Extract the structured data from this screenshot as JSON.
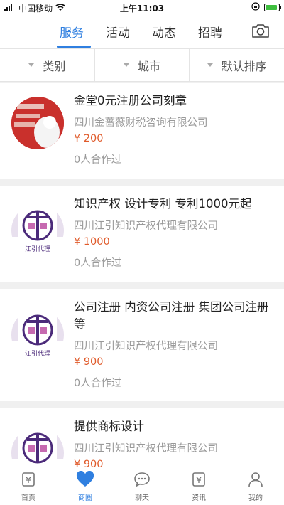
{
  "status": {
    "carrier": "中国移动",
    "time": "上午11:03"
  },
  "tabs": [
    {
      "label": "服务",
      "active": true
    },
    {
      "label": "活动",
      "active": false
    },
    {
      "label": "动态",
      "active": false
    },
    {
      "label": "招聘",
      "active": false
    }
  ],
  "filters": [
    {
      "label": "类别"
    },
    {
      "label": "城市"
    },
    {
      "label": "默认排序"
    }
  ],
  "listings": [
    {
      "title": "金堂0元注册公司刻章",
      "company": "四川金蔷薇财税咨询有限公司",
      "price": "¥ 200",
      "coop": "0人合作过",
      "thumb": "red-promo-image"
    },
    {
      "title": "知识产权 设计专利 专利1000元起",
      "company": "四川江引知识产权代理有限公司",
      "price": "¥ 1000",
      "coop": "0人合作过",
      "thumb": "jiangyin-logo"
    },
    {
      "title": "公司注册 内资公司注册 集团公司注册等",
      "company": "四川江引知识产权代理有限公司",
      "price": "¥ 900",
      "coop": "0人合作过",
      "thumb": "jiangyin-logo"
    },
    {
      "title": "提供商标设计",
      "company": "四川江引知识产权代理有限公司",
      "price": "¥ 900",
      "coop": "",
      "thumb": "jiangyin-logo"
    }
  ],
  "bottom_tabs": [
    {
      "label": "首页",
      "icon": "home-icon",
      "active": false
    },
    {
      "label": "商圈",
      "icon": "heart-icon",
      "active": true
    },
    {
      "label": "聊天",
      "icon": "chat-icon",
      "active": false
    },
    {
      "label": "资讯",
      "icon": "news-icon",
      "active": false
    },
    {
      "label": "我的",
      "icon": "profile-icon",
      "active": false
    }
  ],
  "colors": {
    "accent": "#2f7fe0",
    "price": "#e05a2a",
    "logo_purple": "#4b2a7a"
  }
}
